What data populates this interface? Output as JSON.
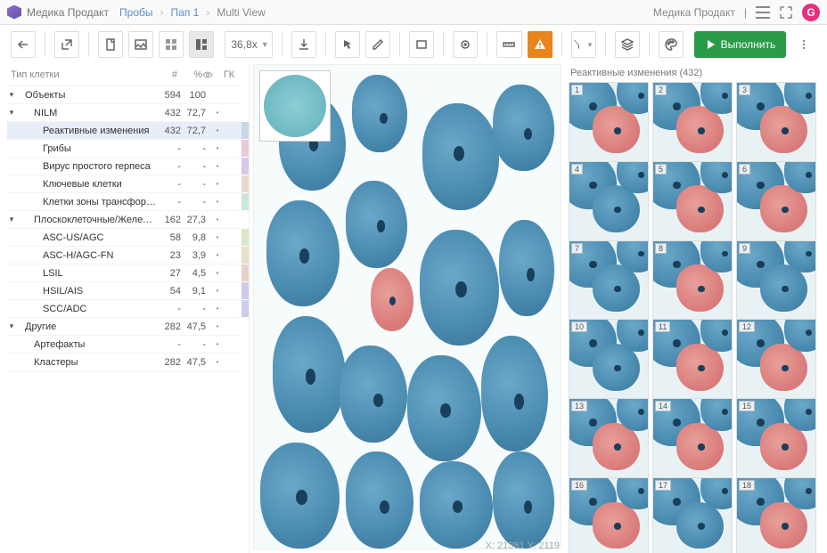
{
  "brand": "Медика Продакт",
  "breadcrumbs": {
    "items": [
      "Пробы",
      "Пап 1",
      "Multi View"
    ]
  },
  "topright": {
    "brand": "Медика Продакт",
    "avatar": "G"
  },
  "zoom": {
    "value": "36,8x"
  },
  "run": {
    "label": "Выполнить"
  },
  "sidebar": {
    "headers": {
      "type": "Тип клетки",
      "count": "#",
      "pct": "%",
      "eye": "👁",
      "gk": "ГК"
    },
    "rows": [
      {
        "lv": 1,
        "caret": "▾",
        "label": "Объекты",
        "n": "594",
        "p": "100",
        "e": "",
        "chip": ""
      },
      {
        "lv": 2,
        "caret": "▾",
        "label": "NILM",
        "n": "432",
        "p": "72,7",
        "e": "•",
        "chip": ""
      },
      {
        "lv": 3,
        "caret": "",
        "label": "Реактивные изменения",
        "n": "432",
        "p": "72,7",
        "e": "•",
        "chip": "#c9d8e8",
        "sel": true
      },
      {
        "lv": 3,
        "caret": "",
        "label": "Грибы",
        "n": "-",
        "p": "-",
        "e": "•",
        "chip": "#e8c9d8"
      },
      {
        "lv": 3,
        "caret": "",
        "label": "Вирус простого герпеса",
        "n": "-",
        "p": "-",
        "e": "•",
        "chip": "#d8c9e8"
      },
      {
        "lv": 3,
        "caret": "",
        "label": "Ключевые клетки",
        "n": "-",
        "p": "-",
        "e": "•",
        "chip": "#e8d8c9"
      },
      {
        "lv": 3,
        "caret": "",
        "label": "Клетки зоны трансформа...",
        "n": "-",
        "p": "-",
        "e": "•",
        "chip": "#c9e8d8"
      },
      {
        "lv": 2,
        "caret": "▾",
        "label": "Плоскоклеточные/Железис...",
        "n": "162",
        "p": "27,3",
        "e": "•",
        "chip": ""
      },
      {
        "lv": 3,
        "caret": "",
        "label": "ASC-US/AGC",
        "n": "58",
        "p": "9,8",
        "e": "•",
        "chip": "#d8e8c9"
      },
      {
        "lv": 3,
        "caret": "",
        "label": "ASC-H/AGC-FN",
        "n": "23",
        "p": "3,9",
        "e": "•",
        "chip": "#e8e0c9"
      },
      {
        "lv": 3,
        "caret": "",
        "label": "LSIL",
        "n": "27",
        "p": "4,5",
        "e": "•",
        "chip": "#e8d0c9"
      },
      {
        "lv": 3,
        "caret": "",
        "label": "HSIL/AIS",
        "n": "54",
        "p": "9,1",
        "e": "•",
        "chip": "#d0c9e8"
      },
      {
        "lv": 3,
        "caret": "",
        "label": "SCC/ADC",
        "n": "-",
        "p": "-",
        "e": "•",
        "chip": "#c9d0e8"
      },
      {
        "lv": 1,
        "caret": "▾",
        "label": "Другие",
        "n": "282",
        "p": "47,5",
        "e": "•",
        "chip": ""
      },
      {
        "lv": 2,
        "caret": "",
        "label": "Артефакты",
        "n": "-",
        "p": "-",
        "e": "•",
        "chip": ""
      },
      {
        "lv": 2,
        "caret": "",
        "label": "Кластеры",
        "n": "282",
        "p": "47,5",
        "e": "•",
        "chip": ""
      }
    ]
  },
  "viewer": {
    "coords": "X: 21381 Y: 2119"
  },
  "gallery": {
    "title": "Реактивные изменения (432)",
    "items": [
      1,
      2,
      3,
      4,
      5,
      6,
      7,
      8,
      9,
      10,
      11,
      12,
      13,
      14,
      15,
      16,
      17,
      18
    ]
  }
}
